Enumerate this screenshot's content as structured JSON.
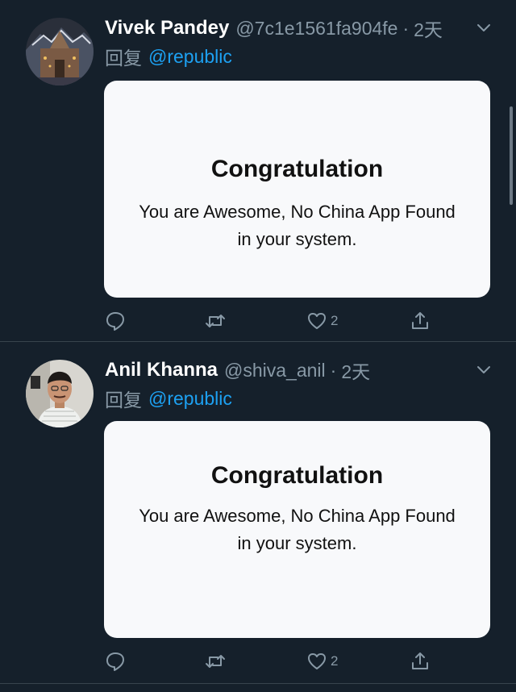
{
  "tweets": [
    {
      "name": "Vivek Pandey",
      "handle": "@7c1e1561fa904fe",
      "separator": "·",
      "time": "2天",
      "reply_prefix": "回复",
      "reply_to": "@republic",
      "card_title": "Congratulation",
      "card_text_line1": "You are Awesome, No China App Found",
      "card_text_line2": "in your system.",
      "like_count": "2",
      "avatar_icon": "temple-photo-avatar"
    },
    {
      "name": "Anil Khanna",
      "handle": "@shiva_anil",
      "separator": "·",
      "time": "2天",
      "reply_prefix": "回复",
      "reply_to": "@republic",
      "card_title": "Congratulation",
      "card_text_line1": "You are Awesome, No China App Found",
      "card_text_line2": "in your system.",
      "like_count": "2",
      "avatar_icon": "person-photo-avatar"
    }
  ],
  "colors": {
    "background": "#15202b",
    "secondary_text": "#8899a6",
    "link": "#1da1f2",
    "divider": "#38444d",
    "card": "#f8f9fb"
  },
  "icons": {
    "reply": "reply-icon",
    "retweet": "retweet-icon",
    "like": "heart-icon",
    "share": "share-icon",
    "menu": "chevron-down-icon"
  }
}
